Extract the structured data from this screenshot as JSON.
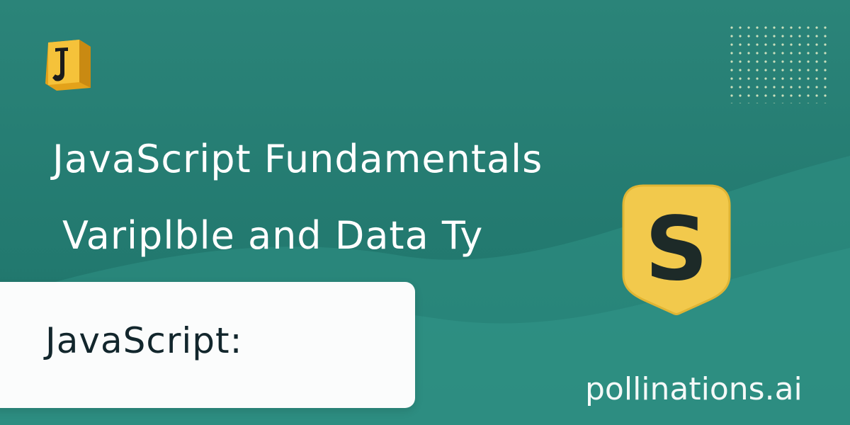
{
  "headline": {
    "line_1": "JavaScript Fundamentals",
    "line_2": "Variplble  and Data Ty"
  },
  "caption_card": {
    "text": "JavaScript:"
  },
  "badge": {
    "letter": "S"
  },
  "logo": {
    "icon": "js-logo-icon"
  },
  "watermark": {
    "text": "pollinations.ai"
  },
  "colors": {
    "background": "#2b8479",
    "badge_yellow": "#f2c94c",
    "card": "#fbfcfc",
    "caption_text": "#12262c"
  }
}
